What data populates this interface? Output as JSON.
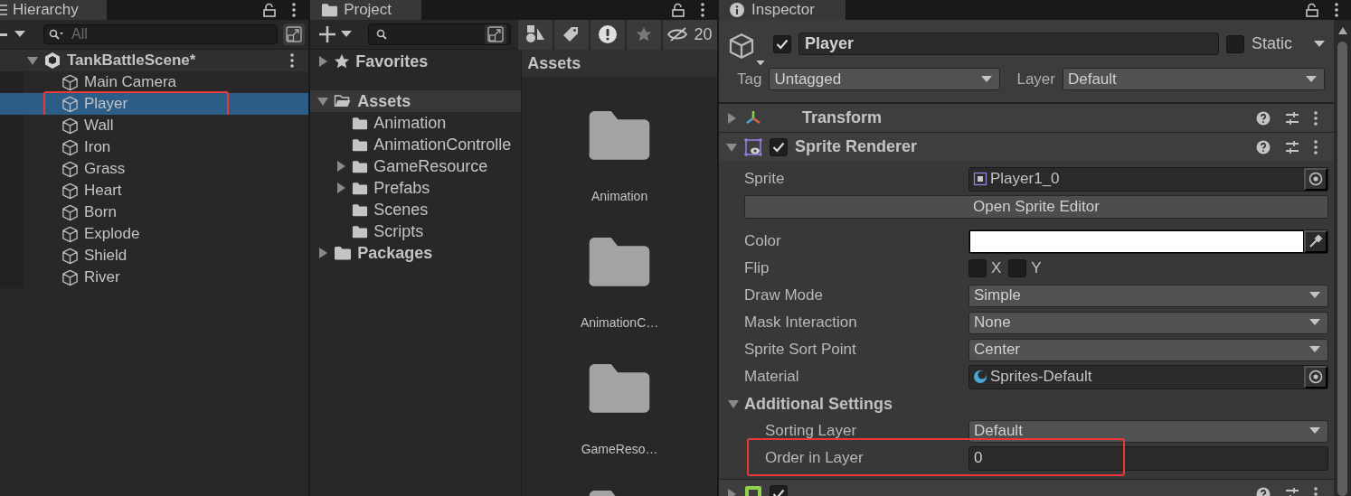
{
  "hierarchy": {
    "tab": "Hierarchy",
    "search": {
      "placeholder": "All"
    },
    "scene": {
      "name": "TankBattleScene*",
      "expanded": true,
      "children": [
        {
          "name": "Main Camera",
          "selected": false,
          "highlighted": false
        },
        {
          "name": "Player",
          "selected": true,
          "highlighted": true
        },
        {
          "name": "Wall",
          "selected": false,
          "highlighted": false
        },
        {
          "name": "Iron",
          "selected": false,
          "highlighted": false
        },
        {
          "name": "Grass",
          "selected": false,
          "highlighted": false
        },
        {
          "name": "Heart",
          "selected": false,
          "highlighted": false
        },
        {
          "name": "Born",
          "selected": false,
          "highlighted": false
        },
        {
          "name": "Explode",
          "selected": false,
          "highlighted": false
        },
        {
          "name": "Shield",
          "selected": false,
          "highlighted": false
        },
        {
          "name": "River",
          "selected": false,
          "highlighted": false
        }
      ]
    }
  },
  "project": {
    "tab": "Project",
    "hidden_count": "20",
    "tree": [
      {
        "name": "Favorites",
        "kind": "favorites",
        "expanded": false,
        "selected": false
      },
      {
        "name": "Assets",
        "kind": "folder",
        "expanded": true,
        "selected": true,
        "children": [
          {
            "name": "Animation",
            "expandable": false
          },
          {
            "name": "AnimationControlle",
            "expandable": false
          },
          {
            "name": "GameResource",
            "expandable": true
          },
          {
            "name": "Prefabs",
            "expandable": true
          },
          {
            "name": "Scenes",
            "expandable": false
          },
          {
            "name": "Scripts",
            "expandable": false
          }
        ]
      },
      {
        "name": "Packages",
        "kind": "folder",
        "expanded": false,
        "selected": false
      }
    ],
    "grid": {
      "title": "Assets",
      "items": [
        {
          "kind": "folder",
          "name": "Animation"
        },
        {
          "kind": "folder",
          "name": "AnimationC…"
        },
        {
          "kind": "folder",
          "name": "GameReso…"
        },
        {
          "kind": "folder"
        }
      ]
    }
  },
  "inspector": {
    "tab": "Inspector",
    "object": {
      "active": true,
      "name": "Player",
      "static": false,
      "static_label": "Static",
      "tag_label": "Tag",
      "tag": "Untagged",
      "layer_label": "Layer",
      "layer": "Default"
    },
    "components": [
      {
        "kind": "transform",
        "name": "Transform",
        "expanded": false
      },
      {
        "kind": "sprite",
        "name": "Sprite Renderer",
        "expanded": true,
        "enabled": true,
        "properties": [
          {
            "kind": "sprite_ref",
            "label": "Sprite",
            "value": "Player1_0"
          },
          {
            "kind": "button",
            "label": "Open Sprite Editor"
          },
          {
            "kind": "color",
            "label": "Color",
            "color": "#ffffff"
          },
          {
            "kind": "flip",
            "label": "Flip",
            "x_label": "X",
            "x_checked": false,
            "y_label": "Y",
            "y_checked": false
          },
          {
            "kind": "dropdown",
            "label": "Draw Mode",
            "value": "Simple"
          },
          {
            "kind": "dropdown",
            "label": "Mask Interaction",
            "value": "None"
          },
          {
            "kind": "dropdown",
            "label": "Sprite Sort Point",
            "value": "Center"
          },
          {
            "kind": "material_ref",
            "label": "Material",
            "value": "Sprites-Default"
          },
          {
            "kind": "section",
            "label": "Additional Settings",
            "expanded": true,
            "children": [
              {
                "kind": "dropdown",
                "label": "Sorting Layer",
                "value": "Default",
                "highlighted": false
              },
              {
                "kind": "number",
                "label": "Order in Layer",
                "value": "0",
                "highlighted": true
              }
            ]
          }
        ]
      },
      {
        "kind": "collider",
        "expanded": false,
        "enabled": true
      }
    ]
  }
}
